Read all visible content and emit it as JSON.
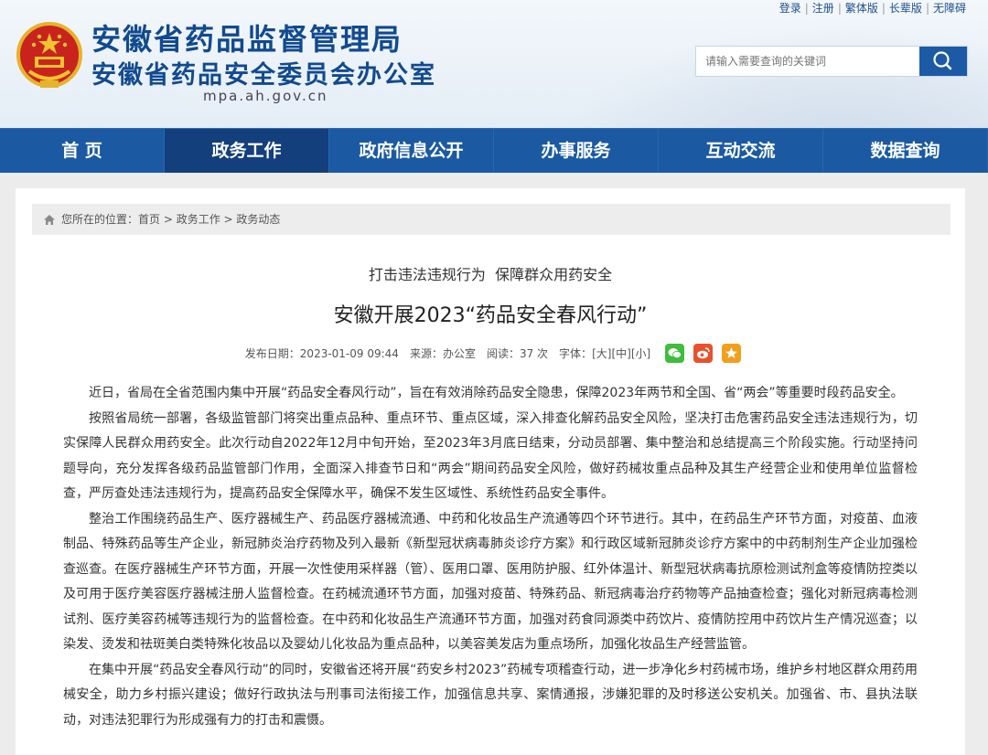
{
  "top_links": [
    "登录",
    "注册",
    "繁体版",
    "长辈版",
    "无障碍"
  ],
  "site": {
    "title1": "安徽省药品监督管理局",
    "title2": "安徽省药品安全委员会办公室",
    "domain": "mpa.ah.gov.cn"
  },
  "search": {
    "placeholder": "请输入需要查询的关键词",
    "icon": "search-icon"
  },
  "nav": [
    "首 页",
    "政务工作",
    "政府信息公开",
    "办事服务",
    "互动交流",
    "数据查询"
  ],
  "breadcrumb": {
    "prefix": "您所在的位置：",
    "items": [
      "首页",
      "政务工作",
      "政务动态"
    ],
    "separator": " > "
  },
  "article": {
    "subtitle": "打击违法违规行为  保障群众用药安全",
    "headline": "安徽开展2023“药品安全春风行动”",
    "meta": {
      "date": "发布日期：2023-01-09 09:44",
      "source": "来源：办公室",
      "reads": "阅读：37 次",
      "font_label": "字体：",
      "sizes": [
        "[大]",
        "[中]",
        "[小]"
      ]
    },
    "share": [
      "wechat-icon",
      "weibo-icon",
      "star-icon"
    ],
    "paragraphs": [
      "近日，省局在全省范围内集中开展“药品安全春风行动”，旨在有效消除药品安全隐患，保障2023年两节和全国、省“两会”等重要时段药品安全。",
      "按照省局统一部署，各级监管部门将突出重点品种、重点环节、重点区域，深入排查化解药品安全风险，坚决打击危害药品安全违法违规行为，切实保障人民群众用药安全。此次行动自2022年12月中旬开始，至2023年3月底日结束，分动员部署、集中整治和总结提高三个阶段实施。行动坚持问题导向，充分发挥各级药品监管部门作用，全面深入排查节日和“两会”期间药品安全风险，做好药械妆重点品种及其生产经营企业和使用单位监督检查，严厉查处违法违规行为，提高药品安全保障水平，确保不发生区域性、系统性药品安全事件。",
      "整治工作围绕药品生产、医疗器械生产、药品医疗器械流通、中药和化妆品生产流通等四个环节进行。其中，在药品生产环节方面，对疫苗、血液制品、特殊药品等生产企业，新冠肺炎治疗药物及列入最新《新型冠状病毒肺炎诊疗方案》和行政区域新冠肺炎诊疗方案中的中药制剂生产企业加强检查巡查。在医疗器械生产环节方面，开展一次性使用采样器（管）、医用口罩、医用防护服、红外体温计、新型冠状病毒抗原检测试剂盒等疫情防控类以及可用于医疗美容医疗器械注册人监督检查。在药械流通环节方面，加强对疫苗、特殊药品、新冠病毒治疗药物等产品抽查检查；强化对新冠病毒检测试剂、医疗美容药械等违规行为的监督检查。在中药和化妆品生产流通环节方面，加强对药食同源类中药饮片、疫情防控用中药饮片生产情况巡查；以染发、烫发和祛斑美白类特殊化妆品以及婴幼儿化妆品为重点品种，以美容美发店为重点场所，加强化妆品生产经营监管。",
      "在集中开展“药品安全春风行动”的同时，安徽省还将开展“药安乡村2023”药械专项稽查行动，进一步净化乡村药械市场，维护乡村地区群众用药用械安全，助力乡村振兴建设；做好行政执法与刑事司法衔接工作，加强信息共享、案情通报，涉嫌犯罪的及时移送公安机关。加强省、市、县执法联动，对违法犯罪行为形成强有力的打击和震慑。"
    ]
  },
  "colors": {
    "brand": "#114a8f",
    "nav": "#1b5aa2",
    "nav_active": "#133f7c"
  }
}
